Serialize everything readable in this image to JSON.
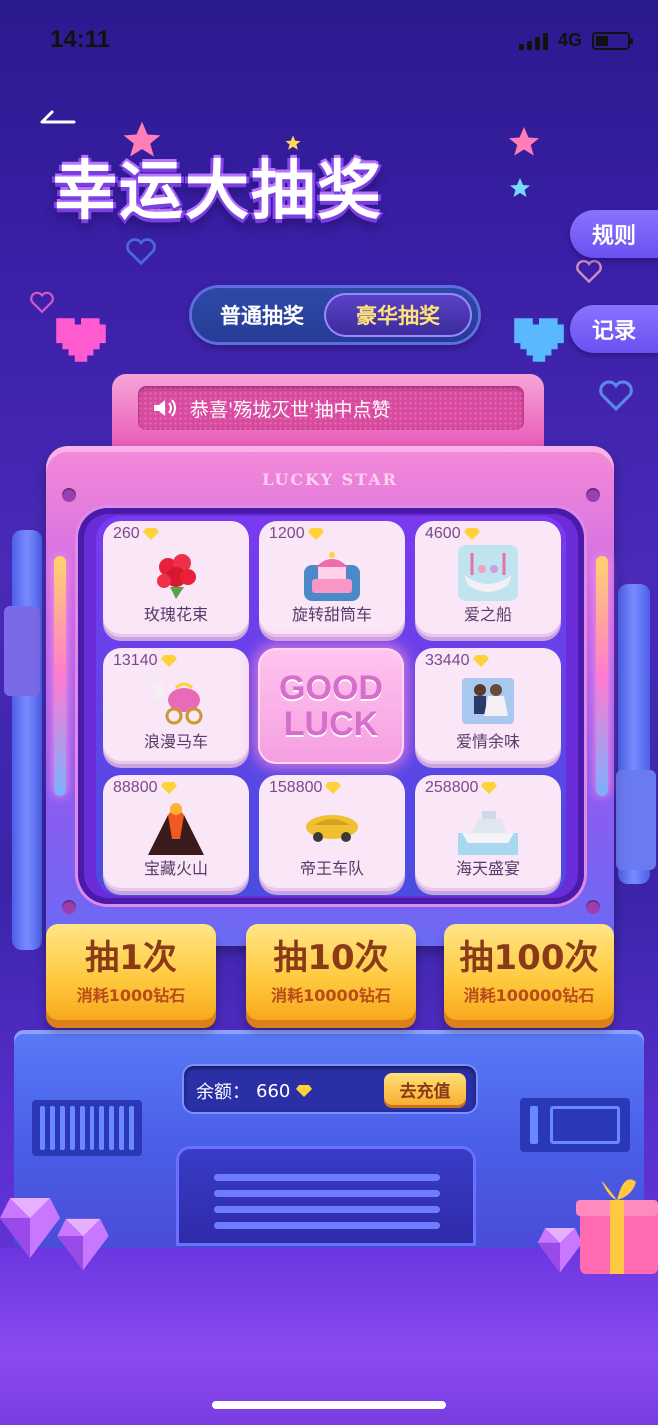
{
  "status": {
    "time": "14:11",
    "network": "4G"
  },
  "title": "幸运大抽奖",
  "side_buttons": {
    "rules": "规则",
    "records": "记录"
  },
  "tabs": {
    "normal": "普通抽奖",
    "luxury": "豪华抽奖",
    "active": "luxury"
  },
  "marquee": {
    "text": "恭喜'殇垅灭世'抽中点赞"
  },
  "machine": {
    "brand": "LUCKY STAR"
  },
  "prizes": [
    {
      "price": "260",
      "name": "玫瑰花束",
      "icon": "rose-bouquet-icon"
    },
    {
      "price": "1200",
      "name": "旋转甜筒车",
      "icon": "carousel-cake-icon"
    },
    {
      "price": "4600",
      "name": "爱之船",
      "icon": "love-boat-icon"
    },
    {
      "price": "13140",
      "name": "浪漫马车",
      "icon": "carriage-icon"
    },
    {
      "price": "33440",
      "name": "爱情余味",
      "icon": "couple-icon"
    },
    {
      "price": "88800",
      "name": "宝藏火山",
      "icon": "volcano-icon"
    },
    {
      "price": "158800",
      "name": "帝王车队",
      "icon": "gold-car-icon"
    },
    {
      "price": "258800",
      "name": "海天盛宴",
      "icon": "yacht-icon"
    }
  ],
  "center": {
    "line1": "GOOD",
    "line2": "LUCK"
  },
  "draw_buttons": [
    {
      "main": "抽1次",
      "sub": "消耗1000钻石"
    },
    {
      "main": "抽10次",
      "sub": "消耗10000钻石"
    },
    {
      "main": "抽100次",
      "sub": "消耗100000钻石"
    }
  ],
  "balance": {
    "label": "余额：",
    "value": "660",
    "recharge": "去充值"
  },
  "colors": {
    "accent_gold": "#ffc83c",
    "accent_pink": "#f58ad7",
    "background": "#3a1fa6"
  }
}
